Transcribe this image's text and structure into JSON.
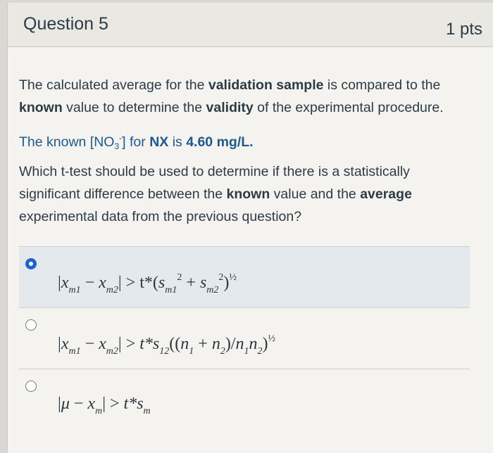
{
  "question": {
    "title": "Question 5",
    "points": "1 pts"
  },
  "text": {
    "p1_a": "The calculated average for the ",
    "p1_b": "validation sample",
    "p1_c": " is compared to the ",
    "p1_d": "known",
    "p1_e": " value to determine the ",
    "p1_f": "validity",
    "p1_g": " of the experimental procedure.",
    "p2_a": "The known [NO",
    "p2_sub": "3",
    "p2_sup": "-",
    "p2_b": "] for ",
    "p2_c": "NX",
    "p2_d": " is ",
    "p2_e": "4.60 mg/L.",
    "p3_a": "Which t-test should be used to determine if there is a statistically significant difference between the ",
    "p3_b": "known",
    "p3_c": " value and the ",
    "p3_d": "average",
    "p3_e": " experimental data from the previous question?"
  },
  "answers": [
    {
      "selected": true,
      "formula": "|x_m1 − x_m2| > t*(s_m1^2 + s_m2^2)^½"
    },
    {
      "selected": false,
      "formula": "|x_m1 − x_m2| > t*s_12((n_1 + n_2)/n_1n_2)^½"
    },
    {
      "selected": false,
      "formula": "|μ − x_m| > t*s_m"
    }
  ],
  "colors": {
    "accent": "#1f63d0",
    "text": "#2d3b45",
    "highlight": "#1d5a8f"
  }
}
